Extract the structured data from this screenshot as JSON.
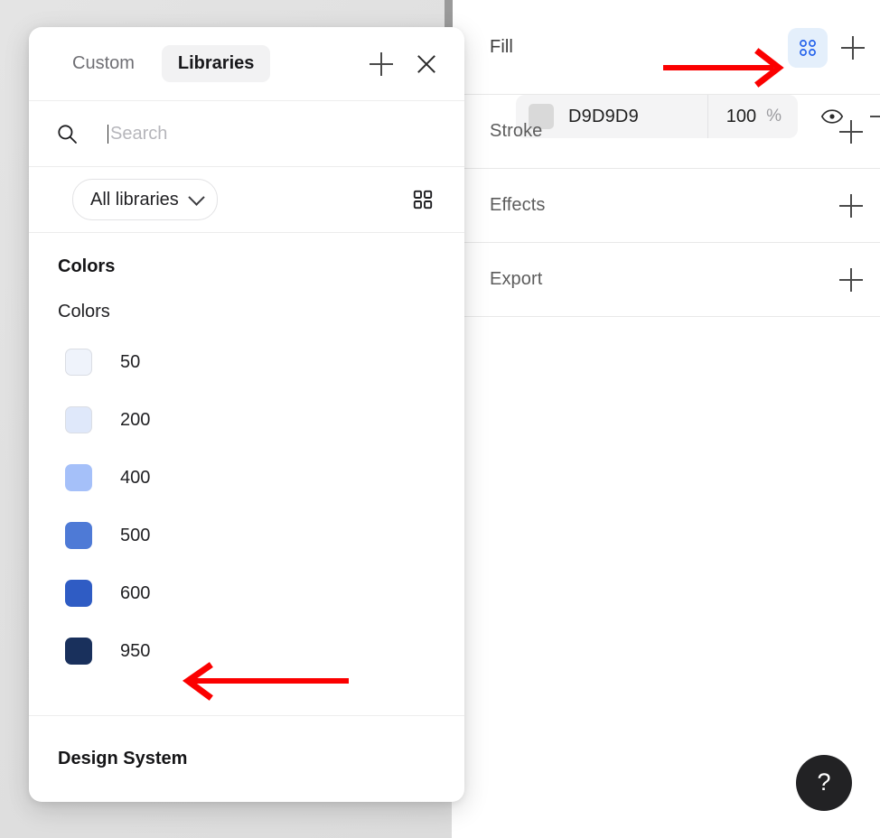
{
  "panel": {
    "sections": [
      {
        "id": "fill",
        "title": "Fill"
      },
      {
        "id": "stroke",
        "title": "Stroke"
      },
      {
        "id": "effects",
        "title": "Effects"
      },
      {
        "id": "export",
        "title": "Export"
      }
    ],
    "fill": {
      "title": "Fill",
      "libraries_icon": "libraries-grid-icon",
      "libraries_icon_active": true,
      "libraries_icon_active_bg": "#E4EFFB",
      "add_icon": "plus-icon",
      "swatch_color": "#D9D9D9",
      "hex": "D9D9D9",
      "opacity": "100",
      "percent": "%",
      "visibility_icon": "eye-icon",
      "remove_icon": "minus-icon"
    },
    "stroke": {
      "title": "Stroke",
      "add_icon": "plus-icon"
    },
    "effects": {
      "title": "Effects",
      "add_icon": "plus-icon"
    },
    "export": {
      "title": "Export",
      "add_icon": "plus-icon"
    }
  },
  "popover": {
    "tabs": [
      {
        "label": "Custom",
        "active": false
      },
      {
        "label": "Libraries",
        "active": true
      }
    ],
    "add_icon": "plus-icon",
    "close_icon": "close-icon",
    "search": {
      "icon": "search-icon",
      "placeholder": "Search",
      "value": ""
    },
    "filter": {
      "select_label": "All libraries",
      "chevron_icon": "chevron-down-icon",
      "grid_view_icon": "grid-view-icon"
    },
    "groups": [
      {
        "title": "Colors",
        "subtitle": "Colors",
        "swatches": [
          {
            "label": "50",
            "color": "#EFF3FB"
          },
          {
            "label": "200",
            "color": "#DFE8FA"
          },
          {
            "label": "400",
            "color": "#A5C0F9"
          },
          {
            "label": "500",
            "color": "#4E7AD6"
          },
          {
            "label": "600",
            "color": "#2F5CC4"
          },
          {
            "label": "950",
            "color": "#19305C"
          }
        ]
      }
    ],
    "footer": {
      "title": "Design System"
    }
  },
  "help": {
    "icon": "question-mark-icon",
    "label": "?"
  },
  "annotations": {
    "arrow_color": "#FB0000",
    "arrows": [
      {
        "name": "arrow-to-libraries-icon",
        "direction": "right"
      },
      {
        "name": "arrow-to-swatch-950",
        "direction": "left"
      }
    ]
  }
}
